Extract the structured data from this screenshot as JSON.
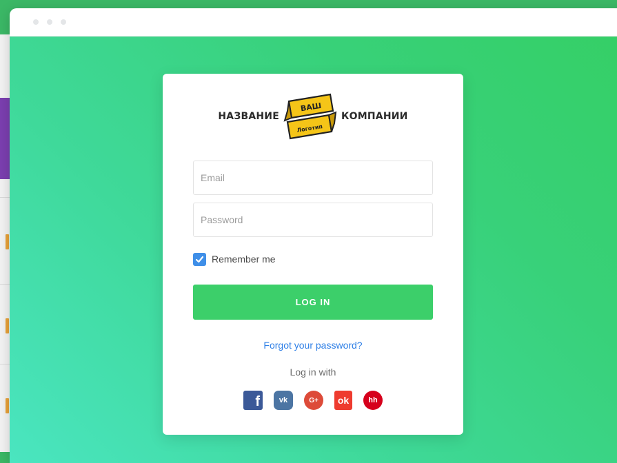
{
  "window": {
    "controls": [
      "dot",
      "dot",
      "dot"
    ]
  },
  "logo": {
    "left_text": "НАЗВАНИЕ",
    "right_text": "КОМПАНИИ",
    "badge_top": "ВАШ",
    "badge_bottom": "Логотип"
  },
  "form": {
    "email_placeholder": "Email",
    "email_value": "",
    "password_placeholder": "Password",
    "password_value": "",
    "remember_label": "Remember me",
    "remember_checked": true,
    "login_button": "LOG IN",
    "forgot_link": "Forgot your password?",
    "login_with": "Log in with"
  },
  "social": [
    {
      "name": "facebook-icon",
      "glyph": "f",
      "color": "#3b5998"
    },
    {
      "name": "vk-icon",
      "glyph": "vk",
      "color": "#4c75a3"
    },
    {
      "name": "google-plus-icon",
      "glyph": "G+",
      "color": "#dd4b39"
    },
    {
      "name": "odnoklassniki-icon",
      "glyph": "ok",
      "color": "#ee3b2f"
    },
    {
      "name": "headhunter-icon",
      "glyph": "hh",
      "color": "#d6001c"
    }
  ],
  "colors": {
    "accent": "#3ccf6a",
    "link": "#2e7fe6",
    "checkbox": "#3f8fe8",
    "logo_badge": "#f5c518"
  }
}
